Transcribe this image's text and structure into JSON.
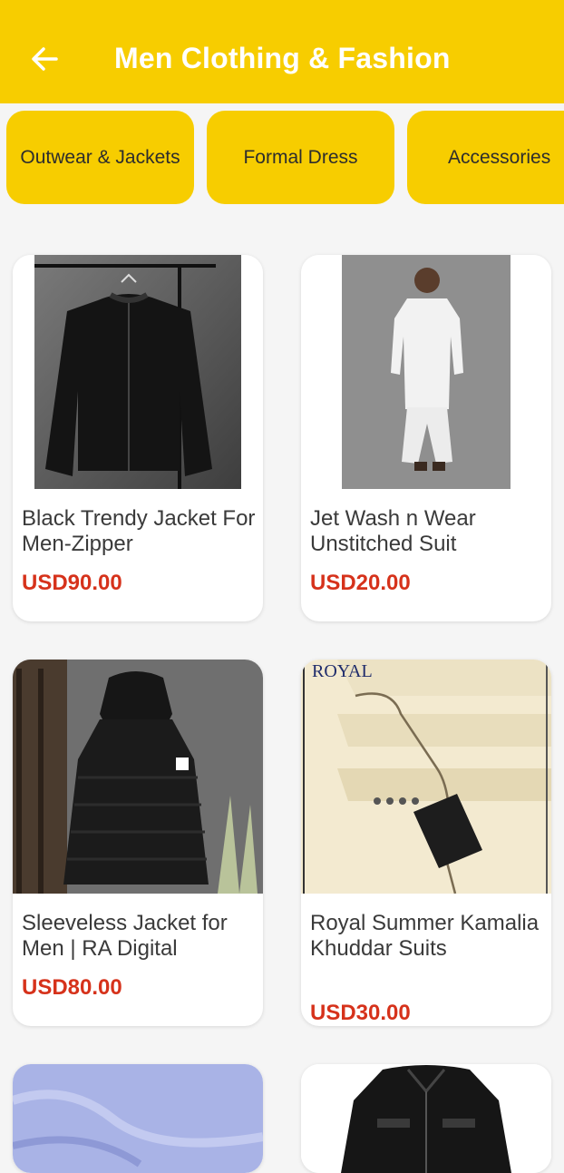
{
  "header": {
    "title": "Men Clothing & Fashion",
    "back_icon": "arrow-left-icon"
  },
  "categories": [
    "Outwear & Jackets",
    "Formal Dress",
    "Accessories"
  ],
  "products": [
    {
      "title": "Black Trendy Jacket For Men-Zipper",
      "price": "USD90.00",
      "image": "black-leather-jacket"
    },
    {
      "title": "Jet Wash n Wear Unstitched Suit",
      "price": "USD20.00",
      "image": "white-kurta-suit"
    },
    {
      "title": "Sleeveless Jacket for Men | RA Digital",
      "price": "USD80.00",
      "image": "black-puffer-vest"
    },
    {
      "title": "Royal Summer Kamalia Khuddar Suits",
      "price": "USD30.00",
      "image": "cream-fabric",
      "brand_text": "ROYAL"
    },
    {
      "title": "",
      "price": "",
      "image": "blue-fabric"
    },
    {
      "title": "",
      "price": "",
      "image": "black-jacket"
    }
  ],
  "colors": {
    "accent": "#f7cd00",
    "price": "#d6321b",
    "background": "#f5f5f5"
  }
}
